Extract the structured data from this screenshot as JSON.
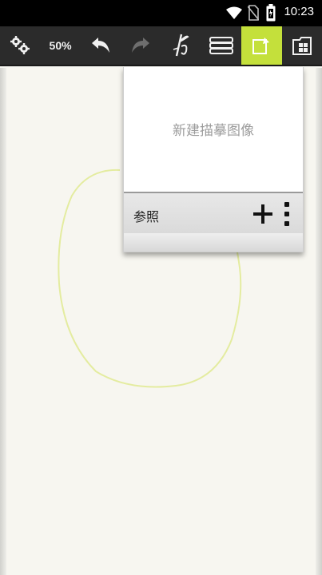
{
  "status_bar": {
    "time": "10:23",
    "icons": [
      "wifi-icon",
      "no-sim-icon",
      "battery-icon"
    ]
  },
  "toolbar": {
    "zoom_label": "50%",
    "buttons": [
      "settings-icon",
      "zoom",
      "undo-icon",
      "redo-icon",
      "brush-icon",
      "layers-icon",
      "new-layer-icon",
      "gallery-icon"
    ],
    "active_button": "new-layer-icon",
    "colors": {
      "bar": "#2b2b2b",
      "active": "#c4e03b",
      "redo_disabled": "#707070"
    }
  },
  "layer_popup": {
    "new_trace_label": "新建描摹图像",
    "reference_label": "参照"
  },
  "canvas": {
    "background": "#f7f6f0",
    "stroke_color": "#e4eca0"
  }
}
